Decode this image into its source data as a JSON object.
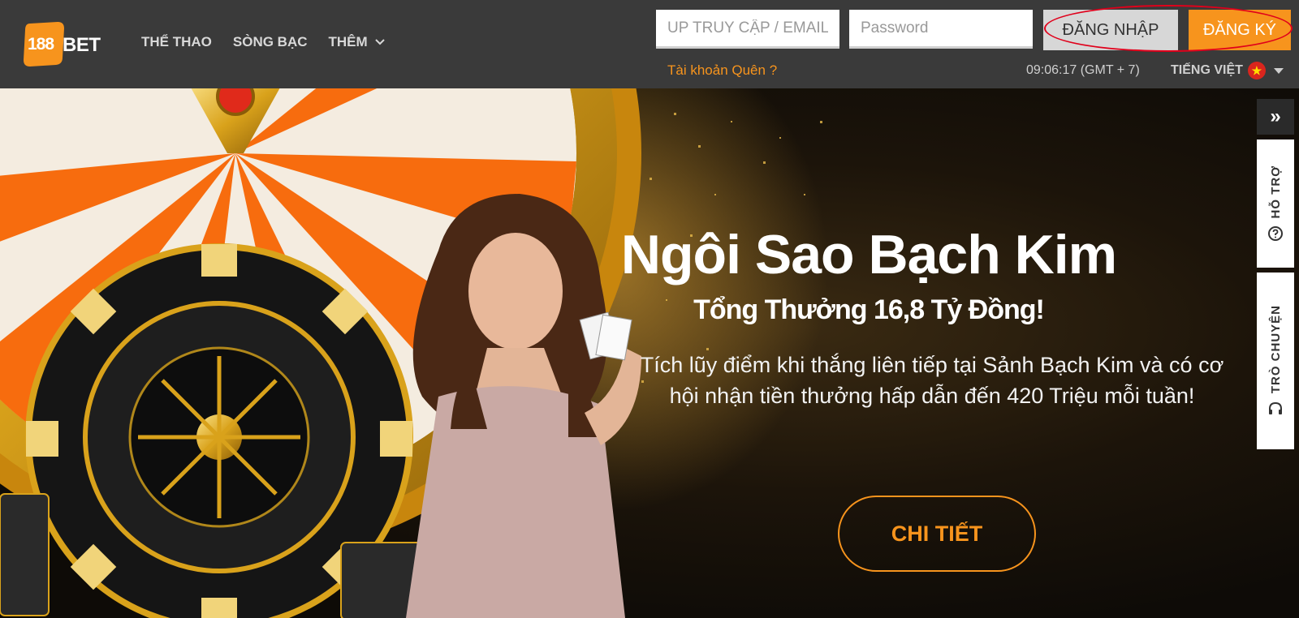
{
  "brand": {
    "number": "188",
    "name": "BET"
  },
  "nav": [
    {
      "label": "THỂ THAO"
    },
    {
      "label": "SÒNG BẠC"
    },
    {
      "label": "THÊM"
    }
  ],
  "login": {
    "username_placeholder": "UP TRUY CẬP / EMAIL",
    "password_placeholder": "Password",
    "login_label": "ĐĂNG NHẬP",
    "register_label": "ĐĂNG KÝ",
    "forgot_label": "Tài khoản Quên ?"
  },
  "status": {
    "clock": "09:06:17 (GMT + 7)",
    "language": "TIẾNG VIỆT"
  },
  "hero": {
    "title": "Ngôi Sao Bạch Kim",
    "subtitle": "Tổng Thưởng 16,8 Tỷ Đồng!",
    "description": "Tích lũy điểm khi thắng liên tiếp tại Sảnh Bạch Kim và có cơ hội nhận tiền thưởng hấp dẫn đến 420 Triệu mỗi tuần!",
    "cta_label": "CHI TIẾT"
  },
  "side": {
    "collapse_icon": "»",
    "support_label": "HỖ TRỢ",
    "chat_label": "TRÒ CHUYỆN"
  },
  "colors": {
    "accent": "#f7941d",
    "header_bg": "#3a3a3a",
    "annotation": "#e0001b"
  }
}
